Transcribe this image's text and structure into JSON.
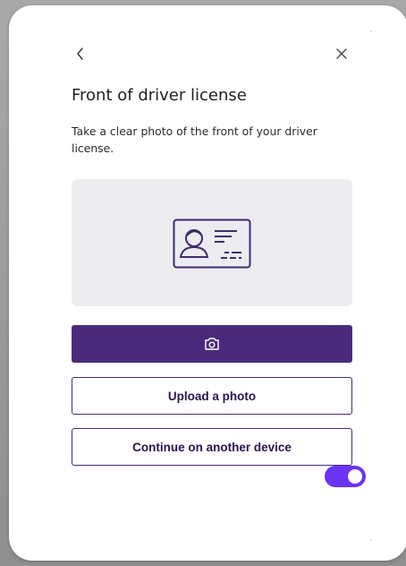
{
  "modal": {
    "title": "Front of driver license",
    "subtitle": "Take a clear photo of the front of your driver license.",
    "back_icon": "chevron-left-icon",
    "close_icon": "close-icon"
  },
  "preview": {
    "icon": "driver-license-icon"
  },
  "buttons": {
    "camera_icon": "camera-icon",
    "upload_label": "Upload a photo",
    "continue_label": "Continue on another device"
  },
  "toggle": {
    "state": "on"
  },
  "colors": {
    "primary": "#4b2a7c",
    "toggle": "#6b33f5",
    "preview_bg": "#ebebf0"
  }
}
